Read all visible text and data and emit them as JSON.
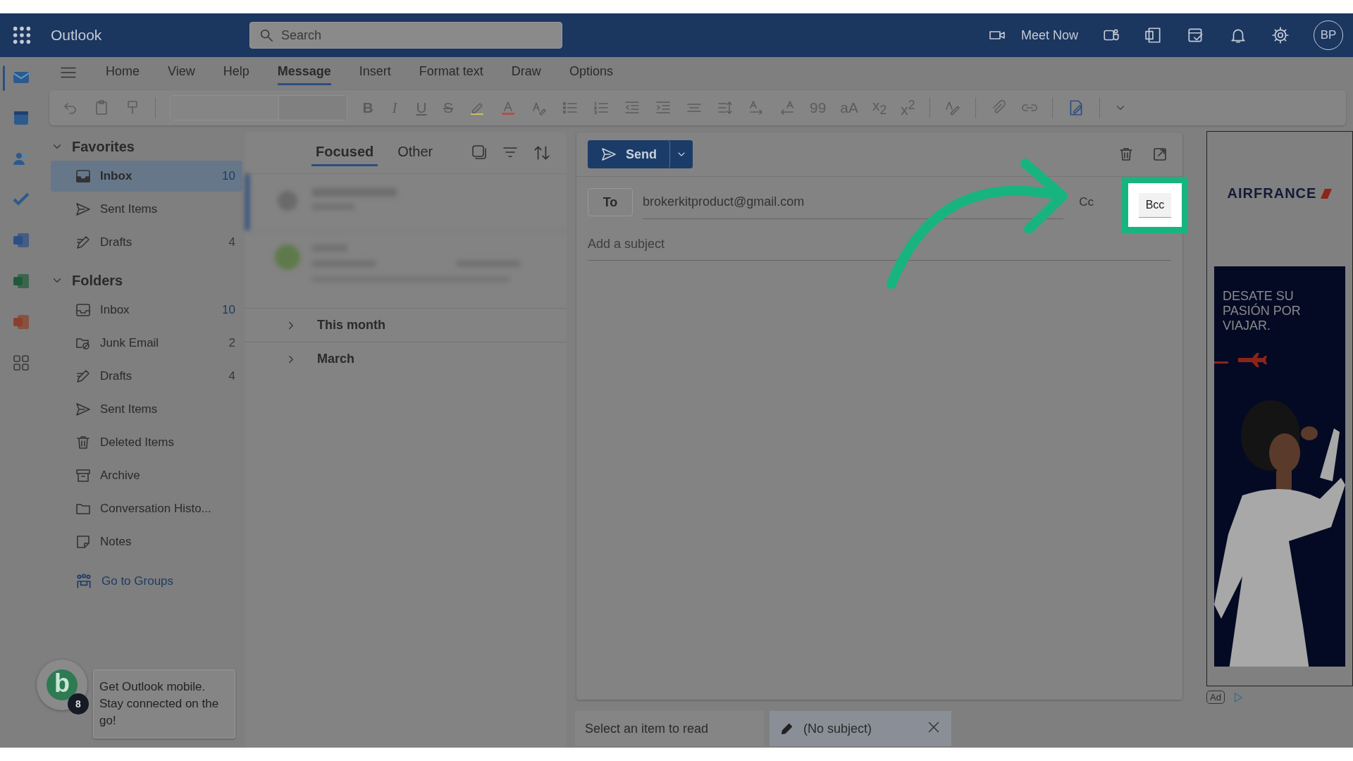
{
  "app": {
    "name": "Outlook",
    "search_placeholder": "Search",
    "meet_now": "Meet Now",
    "avatar": "BP"
  },
  "ribbon_tabs": [
    {
      "label": "Home",
      "selected": false
    },
    {
      "label": "View",
      "selected": false
    },
    {
      "label": "Help",
      "selected": false
    },
    {
      "label": "Message",
      "selected": true
    },
    {
      "label": "Insert",
      "selected": false
    },
    {
      "label": "Format text",
      "selected": false
    },
    {
      "label": "Draw",
      "selected": false
    },
    {
      "label": "Options",
      "selected": false
    }
  ],
  "toolbar_glyphs": [
    "B",
    "I",
    "U",
    "S",
    "99",
    "aA",
    "x$_{2}$",
    "x$^{2}$"
  ],
  "favorites": {
    "title": "Favorites",
    "expanded": true,
    "items": [
      {
        "label": "Inbox",
        "count": "10",
        "unread": true,
        "selected": true
      },
      {
        "label": "Sent Items",
        "selected": false
      },
      {
        "label": "Drafts",
        "count": "4",
        "unread": false,
        "selected": false
      }
    ]
  },
  "folders": {
    "title": "Folders",
    "expanded": true,
    "items": [
      {
        "label": "Inbox",
        "count": "10",
        "unread": true,
        "selected": false
      },
      {
        "label": "Junk Email",
        "count": "2",
        "unread": false,
        "selected": false
      },
      {
        "label": "Drafts",
        "count": "4",
        "unread": false,
        "selected": false
      },
      {
        "label": "Sent Items",
        "selected": false
      },
      {
        "label": "Deleted Items",
        "selected": false
      },
      {
        "label": "Archive",
        "selected": false
      },
      {
        "label": "Conversation Histo...",
        "selected": false
      },
      {
        "label": "Notes",
        "selected": false
      }
    ]
  },
  "go_to_groups": "Go to Groups",
  "list_tabs": [
    {
      "label": "Focused",
      "selected": true
    },
    {
      "label": "Other",
      "selected": false
    }
  ],
  "groups": [
    {
      "label": "This month",
      "expanded": false
    },
    {
      "label": "March",
      "expanded": false
    }
  ],
  "compose": {
    "send": "Send",
    "to": "To",
    "recipient": "brokerkitproduct@gmail.com",
    "cc": "Cc",
    "bcc": "Bcc",
    "subject_placeholder": "Add a subject"
  },
  "ad": {
    "brand": "AIRFRANCE",
    "tagline": "DESATE SU PASIÓN POR VIAJAR.",
    "label": "Ad"
  },
  "promo": {
    "avatar": "b",
    "badge": "8",
    "text": "Get Outlook mobile. Stay connected on the go!"
  },
  "status_bar": [
    {
      "label": "Select an item to read",
      "kind": "plain"
    },
    {
      "label": "(No subject)",
      "kind": "draft"
    }
  ]
}
